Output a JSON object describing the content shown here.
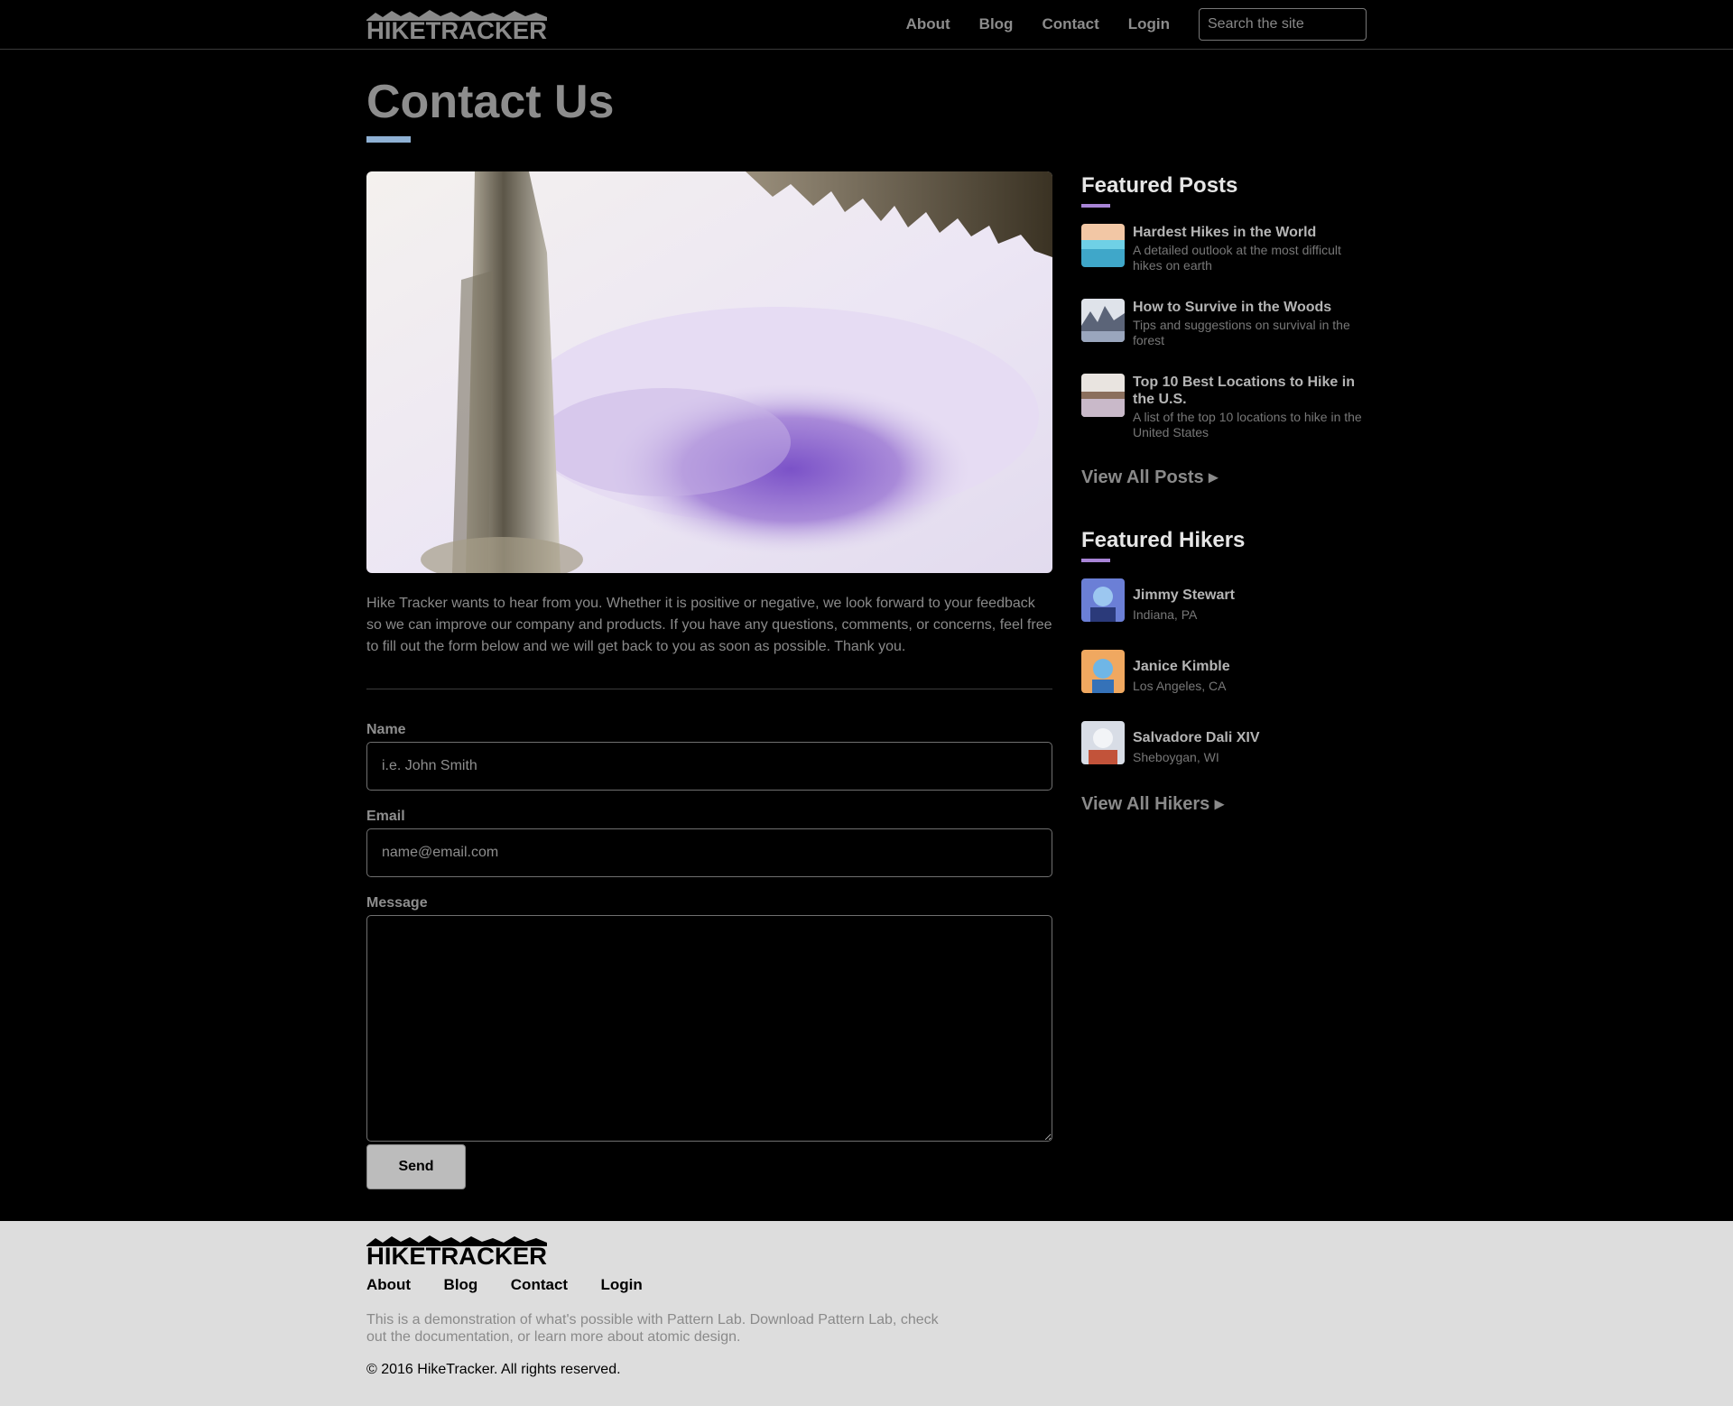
{
  "header": {
    "logo_text": "HIKETRACKER",
    "nav": [
      "About",
      "Blog",
      "Contact",
      "Login"
    ],
    "search_placeholder": "Search the site"
  },
  "page": {
    "title": "Contact Us",
    "intro": "Hike Tracker wants to hear from you. Whether it is positive or negative, we look forward to your feedback so we can improve our company and products. If you have any questions, comments, or concerns, feel free to fill out the form below and we will get back to you as soon as possible. Thank you."
  },
  "form": {
    "name_label": "Name",
    "name_placeholder": "i.e. John Smith",
    "email_label": "Email",
    "email_placeholder": "name@email.com",
    "message_label": "Message",
    "send_label": "Send"
  },
  "sidebar": {
    "posts_heading": "Featured Posts",
    "posts": [
      {
        "title": "Hardest Hikes in the World",
        "desc": "A detailed outlook at the most difficult hikes on earth"
      },
      {
        "title": "How to Survive in the Woods",
        "desc": "Tips and suggestions on survival in the forest"
      },
      {
        "title": "Top 10 Best Locations to Hike in the U.S.",
        "desc": "A list of the top 10 locations to hike in the United States"
      }
    ],
    "view_all_posts": "View All Posts ▸",
    "hikers_heading": "Featured Hikers",
    "hikers": [
      {
        "name": "Jimmy Stewart",
        "location": "Indiana, PA"
      },
      {
        "name": "Janice Kimble",
        "location": "Los Angeles, CA"
      },
      {
        "name": "Salvadore Dali XIV",
        "location": "Sheboygan, WI"
      }
    ],
    "view_all_hikers": "View All Hikers ▸"
  },
  "footer": {
    "logo_text": "HIKETRACKER",
    "nav": [
      "About",
      "Blog",
      "Contact",
      "Login"
    ],
    "text": "This is a demonstration of what's possible with Pattern Lab. Download Pattern Lab, check out the documentation, or learn more about atomic design.",
    "copyright": "© 2016 HikeTracker. All rights reserved."
  },
  "colors": {
    "background": "#000000",
    "title_accent": "#8fb1d4",
    "sidebar_accent": "#a884d6",
    "footer_background": "#dddddd"
  }
}
